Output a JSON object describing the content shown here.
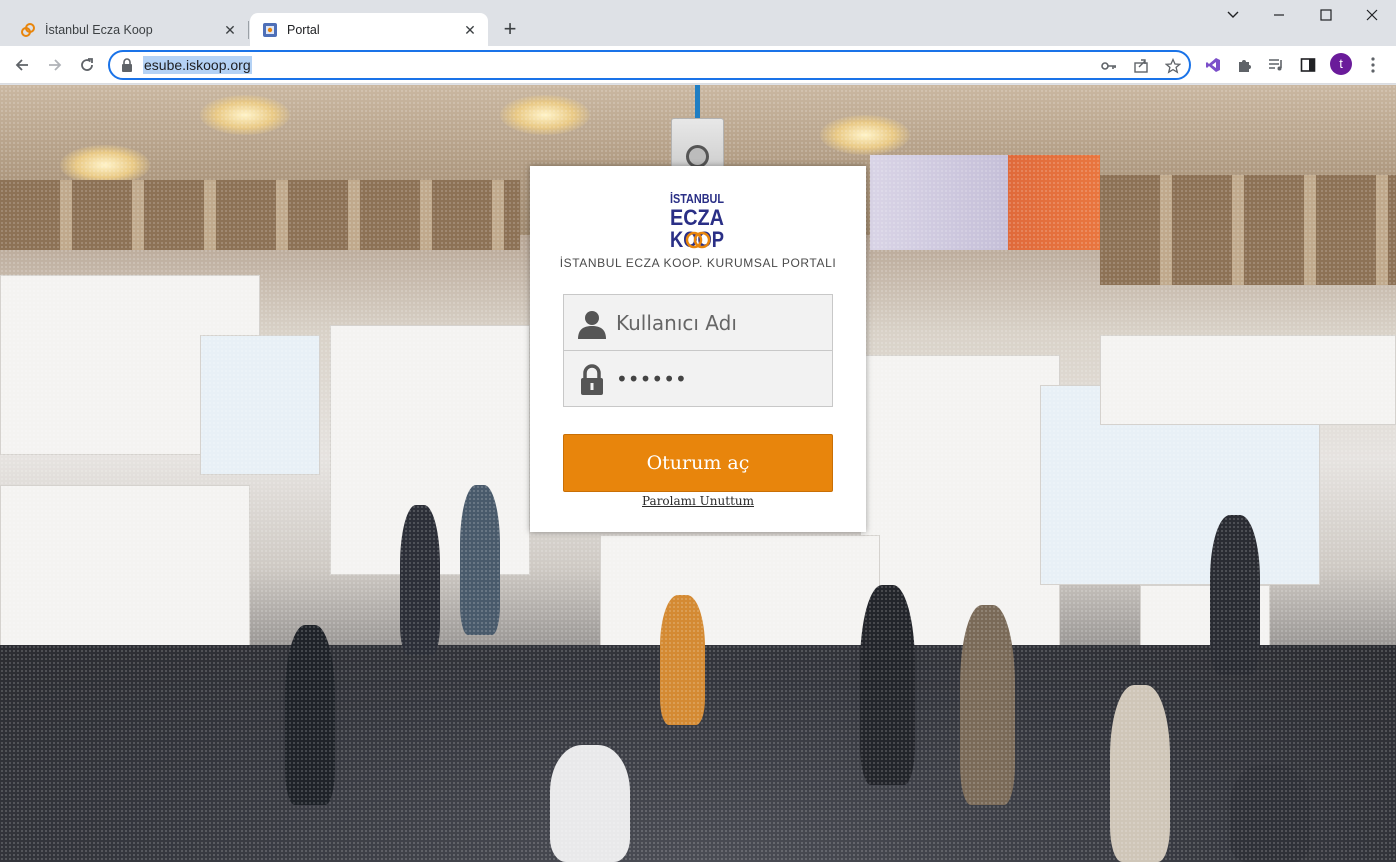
{
  "browser": {
    "tabs": [
      {
        "label": "İstanbul Ecza Koop",
        "icon": "link-icon"
      },
      {
        "label": "Portal",
        "icon": "portal-favicon"
      }
    ],
    "address": "esube.iskoop.org",
    "profile_initial": "t"
  },
  "login": {
    "logo_lines": [
      "İSTANBUL",
      "ECZA",
      "KOOP"
    ],
    "portal_title": "İSTANBUL ECZA KOOP. KURUMSAL PORTALI",
    "username_placeholder": "Kullanıcı Adı",
    "password_value": "••••••",
    "submit_label": "Oturum aç",
    "forgot_label": "Parolamı Unuttum"
  },
  "colors": {
    "accent_button": "#e8850c",
    "browser_focus": "#1a73e8",
    "logo_blue": "#2a2f86",
    "logo_orange": "#e8850c"
  }
}
